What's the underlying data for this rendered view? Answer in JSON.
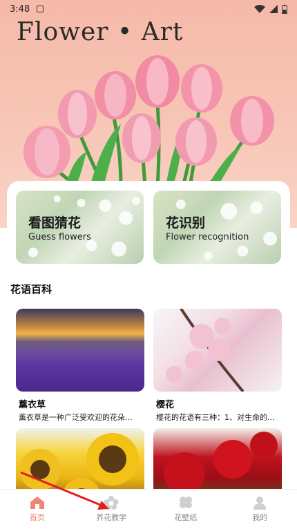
{
  "status_bar": {
    "time": "3:48"
  },
  "hero": {
    "title": "Flower • Art"
  },
  "features": [
    {
      "title": "看图猜花",
      "subtitle": "Guess flowers"
    },
    {
      "title": "花识别",
      "subtitle": "Flower recognition"
    }
  ],
  "section": {
    "title": "花语百科"
  },
  "items": [
    {
      "name": "薰衣草",
      "desc": "薰衣草是一种广泛受欢迎的花朵..."
    },
    {
      "name": "樱花",
      "desc": "樱花的花语有三种：1、对生命的..."
    },
    {
      "name": "",
      "desc": ""
    },
    {
      "name": "",
      "desc": ""
    }
  ],
  "nav": [
    {
      "label": "首页",
      "icon": "home-icon",
      "active": true
    },
    {
      "label": "养花教学",
      "icon": "flower-gear-icon",
      "active": false
    },
    {
      "label": "花壁纸",
      "icon": "clover-icon",
      "active": false
    },
    {
      "label": "我的",
      "icon": "person-icon",
      "active": false
    }
  ],
  "colors": {
    "accent": "#f0786a",
    "hero_bg": "#f7c6b6",
    "arrow": "#e02020"
  }
}
